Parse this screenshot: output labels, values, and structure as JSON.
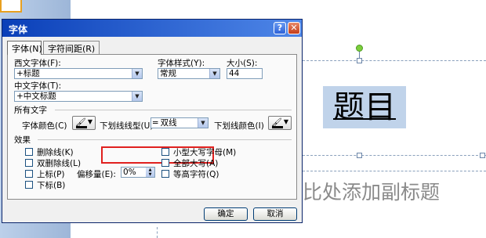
{
  "dialog": {
    "title": "字体",
    "help_glyph": "?",
    "close_glyph": "✕",
    "tabs": [
      {
        "label": "字体(N)",
        "active": true
      },
      {
        "label": "字符间距(R)",
        "active": false
      }
    ]
  },
  "font_section": {
    "western_font_label": "西文字体(F):",
    "western_font_value": "+标题",
    "asian_font_label": "中文字体(T):",
    "asian_font_value": "+中文标题",
    "style_label": "字体样式(Y):",
    "style_value": "常规",
    "size_label": "大小(S):",
    "size_value": "44"
  },
  "all_text": {
    "section_label": "所有文字",
    "font_color_label": "字体颜色(C)",
    "underline_type_label": "下划线线型(U)",
    "underline_type_value": "双线",
    "underline_color_label": "下划线颜色(I)",
    "font_color": "#000000",
    "underline_color": "#000000"
  },
  "effects": {
    "section_label": "效果",
    "left_items": [
      "删除线(K)",
      "双删除线(L)",
      "上标(P)",
      "下标(B)"
    ],
    "right_items": [
      "小型大写字母(M)",
      "全部大写(A)",
      "等高字符(Q)"
    ],
    "offset_label": "偏移量(E):",
    "offset_value": "0%"
  },
  "buttons": {
    "ok": "确定",
    "cancel": "取消"
  },
  "slide": {
    "title": "题目",
    "subtitle": "比处添加副标题"
  },
  "colors": {
    "titlebar": "#0a3fb8",
    "highlight_box": "#e0201e",
    "title_selection": "#c0d3ea"
  }
}
